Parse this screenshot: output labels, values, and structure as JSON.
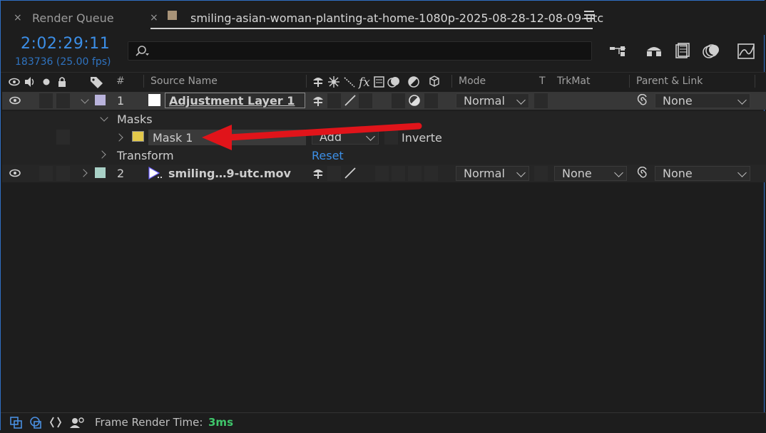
{
  "tabs": {
    "render_queue": "Render Queue",
    "composition": "smiling-asian-woman-planting-at-home-1080p-2025-08-28-12-08-09-utc",
    "close_glyph": "×"
  },
  "timecode": "2:02:29:11",
  "frame_info": "183736 (25.00 fps)",
  "columns": {
    "number": "#",
    "source_name": "Source Name",
    "mode": "Mode",
    "t": "T",
    "trkmat": "TrkMat",
    "parent_link": "Parent & Link"
  },
  "layers": [
    {
      "number": "1",
      "name": "Adjustment Layer 1",
      "label_color": "#b9b3dc",
      "mode": "Normal",
      "parent": "None"
    },
    {
      "number": "2",
      "name": "smiling…9-utc.mov",
      "label_color": "#a8d0c6",
      "mode": "Normal",
      "trkmat": "None",
      "parent": "None"
    }
  ],
  "masks_group": "Masks",
  "mask": {
    "name": "Mask 1",
    "color": "#e2c84a",
    "mode": "Add",
    "inverted_label": "Inverte"
  },
  "transform": {
    "label": "Transform",
    "reset": "Reset"
  },
  "status": {
    "label": "Frame Render Time:",
    "value": "3ms"
  },
  "colors": {
    "accent_blue": "#3c8ee6",
    "reset_blue": "#3d8fe6",
    "status_green": "#3fc66b",
    "arrow_red": "#e0141a"
  }
}
